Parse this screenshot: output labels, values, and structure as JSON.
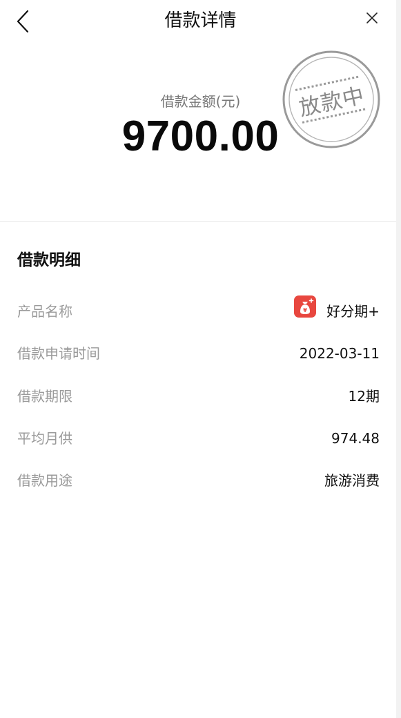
{
  "nav": {
    "title": "借款详情",
    "back_icon": "chevron-left-icon",
    "close_icon": "close-icon"
  },
  "hero": {
    "amount_label": "借款金额(元)",
    "amount_value": "9700.00",
    "stamp_text": "放款中"
  },
  "details": {
    "title": "借款明细",
    "rows": [
      {
        "label": "产品名称",
        "value": "好分期+",
        "icon": "money-bag-icon"
      },
      {
        "label": "借款申请时间",
        "value": "2022-03-11"
      },
      {
        "label": "借款期限",
        "value": "12期"
      },
      {
        "label": "平均月供",
        "value": "974.48"
      },
      {
        "label": "借款用途",
        "value": "旅游消费"
      }
    ]
  },
  "colors": {
    "text_primary": "#111111",
    "text_secondary": "#9a9a9a",
    "stamp_gray": "#8a8a8a",
    "product_icon_red": "#e8473f"
  }
}
